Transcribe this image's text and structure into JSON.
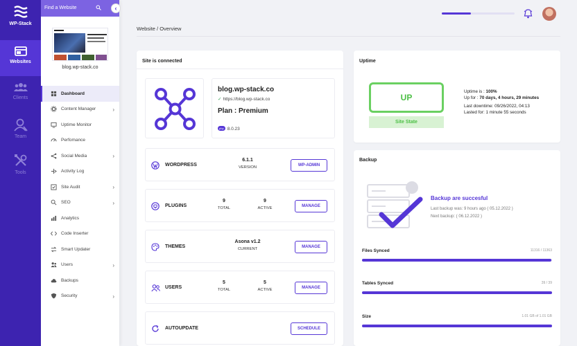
{
  "app": {
    "name": "WP-Stack"
  },
  "rail": [
    {
      "label": "Websites",
      "icon": "websites-icon",
      "active": true
    },
    {
      "label": "Clients",
      "icon": "clients-icon"
    },
    {
      "label": "Team",
      "icon": "team-icon"
    },
    {
      "label": "Tools",
      "icon": "tools-icon"
    }
  ],
  "side": {
    "search_label": "Find a Website",
    "site_url": "blog.wp-stack.co",
    "nav": [
      {
        "label": "Dashboard",
        "icon": "dashboard-icon",
        "active": true
      },
      {
        "label": "Content Manager",
        "icon": "gear-icon",
        "chevron": true
      },
      {
        "label": "Uptime Monitor",
        "icon": "monitor-icon"
      },
      {
        "label": "Perfomance",
        "icon": "gauge-icon"
      },
      {
        "label": "Social Media",
        "icon": "share-icon",
        "chevron": true
      },
      {
        "label": "Activity Log",
        "icon": "log-icon"
      },
      {
        "label": "Site Audit",
        "icon": "audit-icon",
        "chevron": true
      },
      {
        "label": "SEO",
        "icon": "seo-icon",
        "chevron": true
      },
      {
        "label": "Analytics",
        "icon": "analytics-icon"
      },
      {
        "label": "Code Inserter",
        "icon": "code-icon"
      },
      {
        "label": "Smart Updater",
        "icon": "update-icon"
      },
      {
        "label": "Users",
        "icon": "users-icon",
        "chevron": true
      },
      {
        "label": "Backups",
        "icon": "cloud-icon"
      },
      {
        "label": "Security",
        "icon": "shield-icon",
        "chevron": true
      }
    ]
  },
  "topbar": {
    "progress": 0.4
  },
  "breadcrumb": "Website / Overview",
  "connected": {
    "title": "Site is connected",
    "site_name": "blog.wp-stack.co",
    "url": "https://blog.wp-stack.co",
    "plan": "Plan : Premium",
    "php_badge": "php",
    "php_version": "8.0.23"
  },
  "rows": {
    "wordpress": {
      "label": "WORDPRESS",
      "v1": "6.1.1",
      "l1": "VERSION",
      "button": "WP-ADMIN"
    },
    "plugins": {
      "label": "PLUGINS",
      "v1": "9",
      "l1": "TOTAL",
      "v2": "9",
      "l2": "ACTIVE",
      "button": "MANAGE"
    },
    "themes": {
      "label": "THEMES",
      "v1": "Asona v1.2",
      "l1": "CURRENT",
      "button": "MANAGE"
    },
    "users": {
      "label": "USERS",
      "v1": "5",
      "l1": "TOTAL",
      "v2": "5",
      "l2": "ACTIVE",
      "button": "MANAGE"
    },
    "autoupdate": {
      "label": "AUTOUPDATE",
      "button": "SCHEDULE"
    }
  },
  "uptime": {
    "title": "Uptime",
    "state": "UP",
    "state_label": "Site State",
    "uptime_prefix": "Uptime is : ",
    "uptime_value": "100%",
    "upfor_prefix": "Up for : ",
    "upfor_value": "70 days, 4 hours, 29 minutes",
    "last_downtime": "Last downtime: 09/26/2022, 04:13",
    "lasted_for": "Lasted for: 1 minute 55 seconds"
  },
  "backup": {
    "title": "Backup",
    "status": "Backup are succesful",
    "last": "Last backup was: 9 hours ago ( 05.12.2022 )",
    "next": "Next backup: ( 06.12.2022 )",
    "bars": [
      {
        "label": "Files Synced",
        "value": "11316 / 11363",
        "fraction": 0.996
      },
      {
        "label": "Tables Synced",
        "value": "39 / 39",
        "fraction": 1.0
      },
      {
        "label": "Size",
        "value": "1.01 GB of 1.01 GB",
        "fraction": 1.0
      }
    ]
  },
  "colors": {
    "accent": "#5536d6",
    "rail": "#3d23b0",
    "success": "#4cbf45"
  }
}
